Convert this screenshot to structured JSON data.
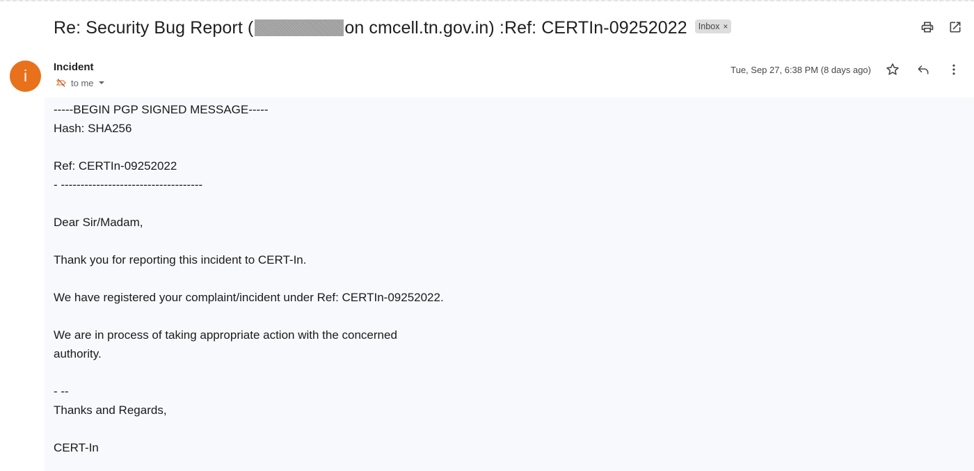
{
  "email": {
    "subject_prefix": "Re: Security Bug Report (",
    "subject_suffix": "on cmcell.tn.gov.in) :Ref: CERTIn-09252022",
    "label_chip": "Inbox",
    "label_chip_close": "×",
    "sender": {
      "avatar_letter": "i",
      "avatar_color": "#e8711c",
      "name": "Incident",
      "recipient": "to me"
    },
    "timestamp": "Tue, Sep 27, 6:38 PM (8 days ago)",
    "body_lines": [
      "-----BEGIN PGP SIGNED MESSAGE-----",
      "Hash: SHA256",
      "",
      "Ref: CERTIn-09252022",
      "- ------------------------------------",
      "",
      "Dear Sir/Madam,",
      "",
      "Thank you for reporting this incident to CERT-In.",
      "",
      "We have registered your complaint/incident under Ref: CERTIn-09252022.",
      "",
      "We are in process of taking appropriate action with the concerned",
      "authority.",
      "",
      "- --",
      "Thanks and Regards,",
      "",
      "CERT-In"
    ]
  },
  "icons": {
    "print": "print-icon",
    "open_new_window": "open-in-new-window-icon",
    "star": "star-icon",
    "reply": "reply-icon",
    "more": "more-vert-icon",
    "not_important": "not-important-icon",
    "dropdown": "chevron-down-icon"
  },
  "colors": {
    "body_background": "#f8f9fd",
    "chip_background": "#dddddd"
  }
}
